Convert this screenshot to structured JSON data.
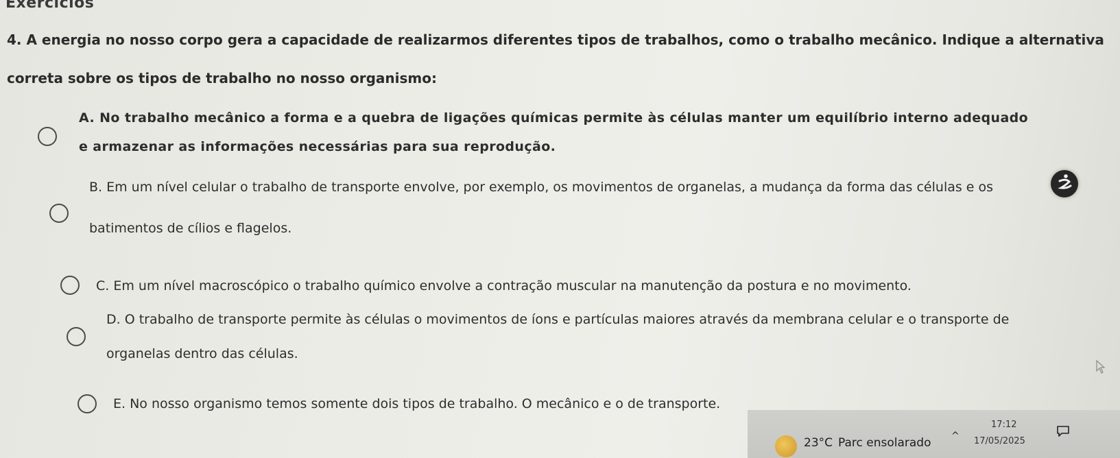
{
  "page": {
    "title": "Exercícios"
  },
  "question": {
    "text": "4. A energia no nosso corpo gera a capacidade de realizarmos diferentes tipos de trabalhos, como o trabalho mecânico. Indique a alternativa correta sobre os tipos de trabalho no nosso organismo:"
  },
  "options": [
    {
      "letter": "A",
      "text": "A. No trabalho mecânico a forma e a quebra de ligações químicas permite às células manter um equilíbrio interno adequado e armazenar as informações necessárias para sua reprodução.",
      "selected": false
    },
    {
      "letter": "B",
      "text": "B. Em um nível celular o trabalho de transporte envolve, por exemplo, os movimentos de organelas, a mudança da forma das células e os batimentos de cílios e flagelos.",
      "selected": false
    },
    {
      "letter": "C",
      "text": "C. Em um nível macroscópico o trabalho químico envolve a contração muscular na manutenção da postura e no movimento.",
      "selected": false
    },
    {
      "letter": "D",
      "text": "D. O trabalho de transporte permite às células o movimentos de íons e partículas maiores através da membrana celular e o transporte de organelas dentro das células.",
      "selected": false
    },
    {
      "letter": "E",
      "text": "E. No nosso organismo temos somente dois tipos de trabalho. O mecânico e o de transporte.",
      "selected": false
    }
  ],
  "taskbar": {
    "temperature": "23°C",
    "weather": "Parc ensolarado",
    "time": "17:12",
    "date": "17/05/2025"
  },
  "icons": {
    "accessibility": "accessibility-icon",
    "weather": "sun-icon",
    "tray": "chevron-up-icon",
    "notifications": "notification-icon"
  }
}
